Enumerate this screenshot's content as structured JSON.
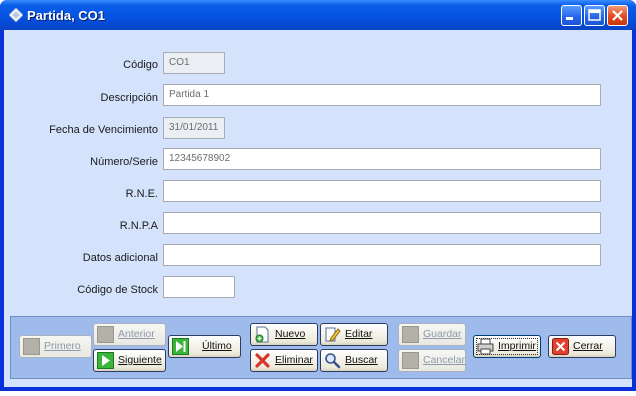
{
  "window": {
    "title": "Partida, CO1"
  },
  "form": {
    "codigo": {
      "label": "Código",
      "value": "CO1"
    },
    "descripcion": {
      "label": "Descripción",
      "value": "Partida 1"
    },
    "vencimiento": {
      "label": "Fecha de Vencimiento",
      "value": "31/01/2011"
    },
    "serie": {
      "label": "Número/Serie",
      "value": "12345678902"
    },
    "rne": {
      "label": "R.N.E.",
      "value": ""
    },
    "rnpa": {
      "label": "R.N.P.A",
      "value": ""
    },
    "datos": {
      "label": "Datos adicional",
      "value": ""
    },
    "stock": {
      "label": "Código de Stock",
      "value": ""
    }
  },
  "buttons": {
    "primero": "Primero",
    "anterior": "Anterior",
    "siguiente": "Siguiente",
    "ultimo": "Último",
    "nuevo": "Nuevo",
    "editar": "Editar",
    "eliminar": "Eliminar",
    "buscar": "Buscar",
    "guardar": "Guardar",
    "cancelar": "Cancelar",
    "imprimir": "Imprimir",
    "cerrar": "Cerrar"
  },
  "colors": {
    "titlebar": "#0654e4",
    "client": "#d4e3fb",
    "buttonbar": "#9ebbec",
    "play": "#3cb43c",
    "delete": "#d9362b"
  }
}
